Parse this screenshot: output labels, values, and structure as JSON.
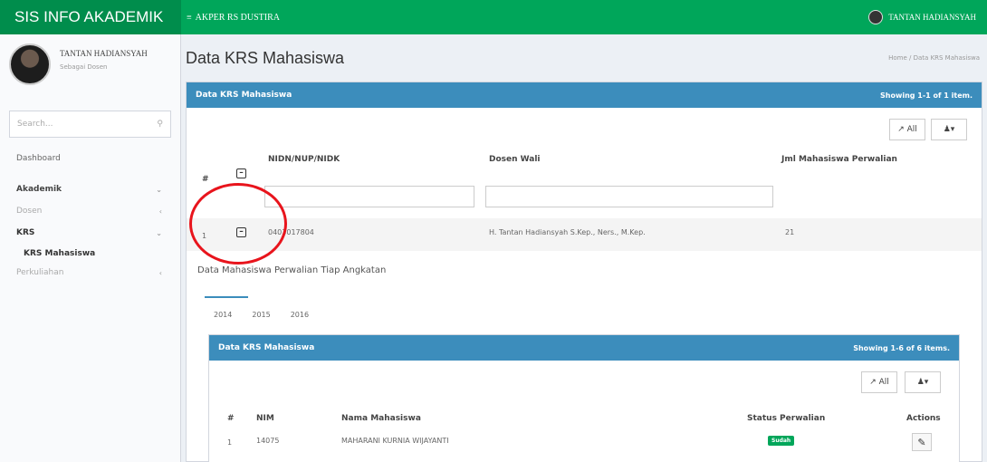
{
  "topbar": {
    "brand": "SIS INFO AKADEMIK",
    "menu_icon": "hamburger-icon",
    "institution": "AKPER RS DUSTIRA",
    "user_name": "TANTAN HADIANSYAH",
    "color": "#00a65a"
  },
  "sidebar": {
    "user_name": "TANTAN HADIANSYAH",
    "user_role": "Sebagai Dosen",
    "search_placeholder": "Search...",
    "items": [
      {
        "label": "Dashboard"
      },
      {
        "label": "Akademik"
      },
      {
        "label": "Dosen"
      },
      {
        "label": "KRS"
      },
      {
        "label": "KRS Mahasiswa"
      },
      {
        "label": "Perkuliahan"
      }
    ]
  },
  "page": {
    "title": "Data KRS Mahasiswa",
    "breadcrumb_home": "Home",
    "breadcrumb_current": "Data KRS Mahasiswa"
  },
  "box1": {
    "title": "Data KRS Mahasiswa",
    "summary": "Showing 1-1 of 1 item.",
    "all_button": "All",
    "columns": [
      "#",
      "NIDN/NUP/NIDK",
      "Dosen Wali",
      "Jml Mahasiswa Perwalian"
    ],
    "row": {
      "no": "1",
      "nidn": "0403017804",
      "dosen": "H. Tantan Hadiansyah S.Kep., Ners., M.Kep.",
      "jumlah": "21"
    }
  },
  "detail": {
    "title": "Data Mahasiswa Perwalian Tiap Angkatan",
    "tabs": [
      "2014",
      "2015",
      "2016"
    ]
  },
  "box2": {
    "title": "Data KRS Mahasiswa",
    "summary": "Showing 1-6 of 6 items.",
    "all_button": "All",
    "columns": [
      "#",
      "NIM",
      "Nama Mahasiswa",
      "Status Perwalian",
      "Actions"
    ],
    "row": {
      "no": "1",
      "nim": "14075",
      "nama": "MAHARANI KURNIA WIJAYANTI",
      "status": "Sudah"
    },
    "status_color": "#00a65a"
  },
  "accent": "#3c8dbc",
  "highlight_color": "#e8141c"
}
